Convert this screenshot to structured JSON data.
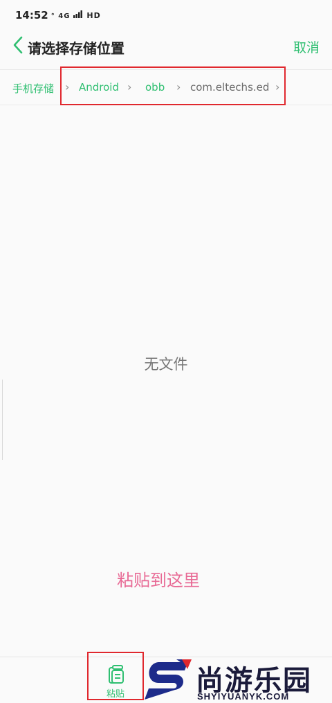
{
  "status_bar": {
    "time": "14:52",
    "network": "4G",
    "hd": "HD"
  },
  "header": {
    "title": "请选择存储位置",
    "cancel_label": "取消"
  },
  "breadcrumb": {
    "items": [
      {
        "label": "手机存储"
      },
      {
        "label": "Android"
      },
      {
        "label": "obb"
      },
      {
        "label": "com.eltechs.ed"
      }
    ]
  },
  "content": {
    "empty_message": "无文件",
    "paste_here": "粘贴到这里"
  },
  "bottom_bar": {
    "paste_label": "粘贴"
  },
  "watermark": {
    "text": "尚游乐园",
    "subtext": "SHYIYUANYK.COM"
  },
  "colors": {
    "accent": "#2fbf71",
    "highlight": "#e0282e",
    "paste_hint": "#e86a95"
  }
}
